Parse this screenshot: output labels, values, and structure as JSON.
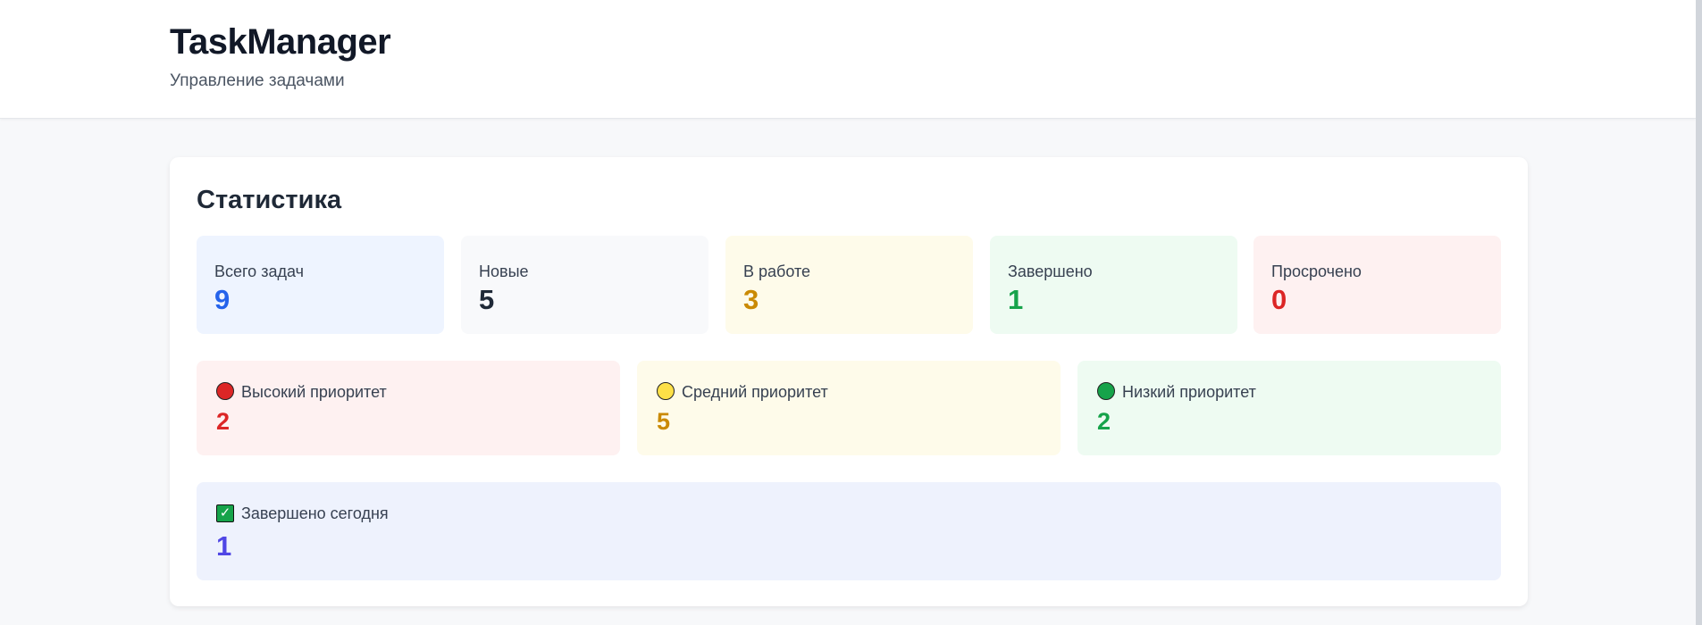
{
  "header": {
    "title": "TaskManager",
    "subtitle": "Управление задачами"
  },
  "stats": {
    "title": "Статистика",
    "overview": [
      {
        "label": "Всего задач",
        "value": "9",
        "color": "#2563eb",
        "bg": "#eef4ff"
      },
      {
        "label": "Новые",
        "value": "5",
        "color": "#1f2937",
        "bg": "#f8f9fb"
      },
      {
        "label": "В работе",
        "value": "3",
        "color": "#ca8a04",
        "bg": "#fefbea"
      },
      {
        "label": "Завершено",
        "value": "1",
        "color": "#16a34a",
        "bg": "#eefbf2"
      },
      {
        "label": "Просрочено",
        "value": "0",
        "color": "#dc2626",
        "bg": "#fef1f1"
      }
    ],
    "priority": [
      {
        "label": "Высокий приоритет",
        "value": "2",
        "icon": "red-circle-icon",
        "dot_color": "#dc2626",
        "color": "#dc2626",
        "bg": "#fef1f1"
      },
      {
        "label": "Средний приоритет",
        "value": "5",
        "icon": "yellow-circle-icon",
        "dot_color": "#fde047",
        "color": "#ca8a04",
        "bg": "#fefbea"
      },
      {
        "label": "Низкий приоритет",
        "value": "2",
        "icon": "green-circle-icon",
        "dot_color": "#16a34a",
        "color": "#16a34a",
        "bg": "#eefbf2"
      }
    ],
    "today": {
      "label": "Завершено сегодня",
      "value": "1",
      "icon": "check-mark-button-icon",
      "icon_glyph": "✓"
    }
  }
}
